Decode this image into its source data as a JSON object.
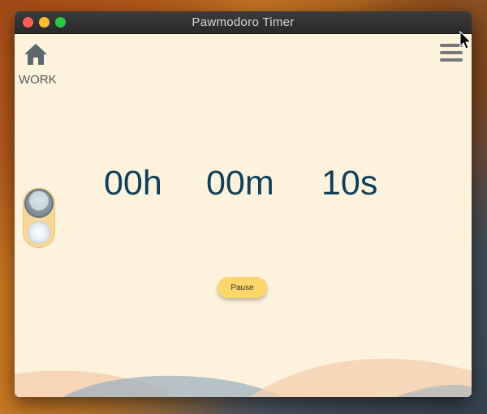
{
  "window": {
    "title": "Pawmodoro Timer"
  },
  "header": {
    "home_icon": "home-icon",
    "mode_label": "WORK",
    "menu_icon": "hamburger-menu-icon"
  },
  "timer": {
    "hours": "00h",
    "minutes": "00m",
    "seconds": "10s"
  },
  "controls": {
    "pause_label": "Pause"
  },
  "colors": {
    "background": "#fdf3dd",
    "timer_text": "#0f3f5a",
    "button": "#fcd66b",
    "wave_peach": "#f5cfb2",
    "wave_slate": "#9fb1bd"
  }
}
